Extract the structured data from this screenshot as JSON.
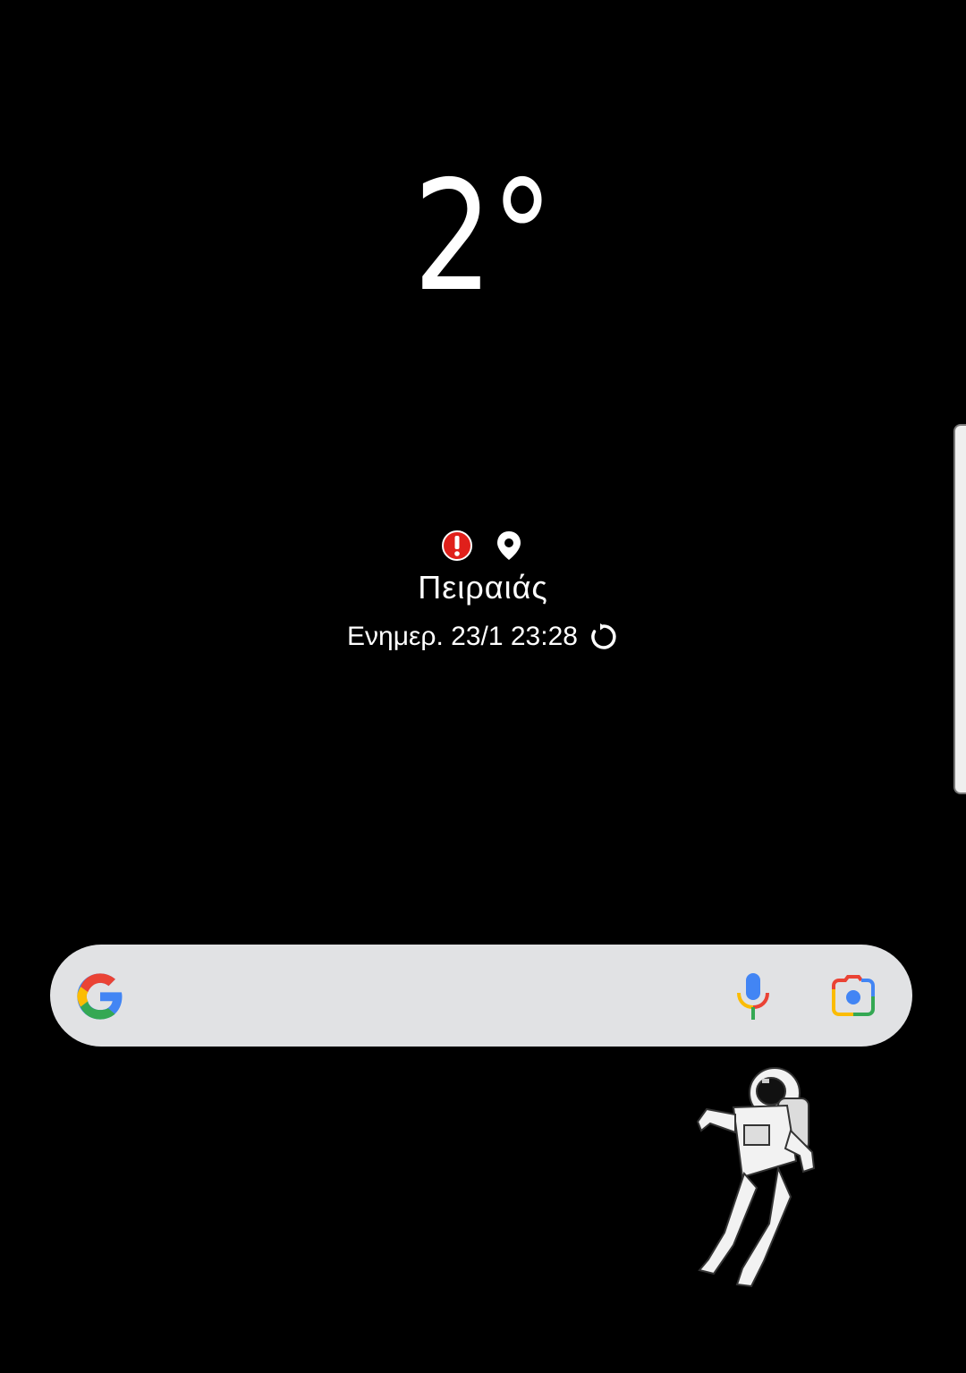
{
  "weather": {
    "temperature": "2°",
    "condition_icon": "moon-icon",
    "location": "Πειραιάς",
    "updated": "Ενημερ. 23/1 23:28"
  },
  "status_icons": [
    "alert-icon",
    "location-pin-icon"
  ],
  "search_bar": {
    "logo": "google-g-icon",
    "voice": "mic-icon",
    "lens": "lens-camera-icon"
  },
  "colors": {
    "background": "#000000",
    "moon": "#FFD600",
    "alert": "#E0201B",
    "search_bar": "#E1E2E4"
  },
  "wallpaper": {
    "decoration": "astronaut-illustration"
  }
}
